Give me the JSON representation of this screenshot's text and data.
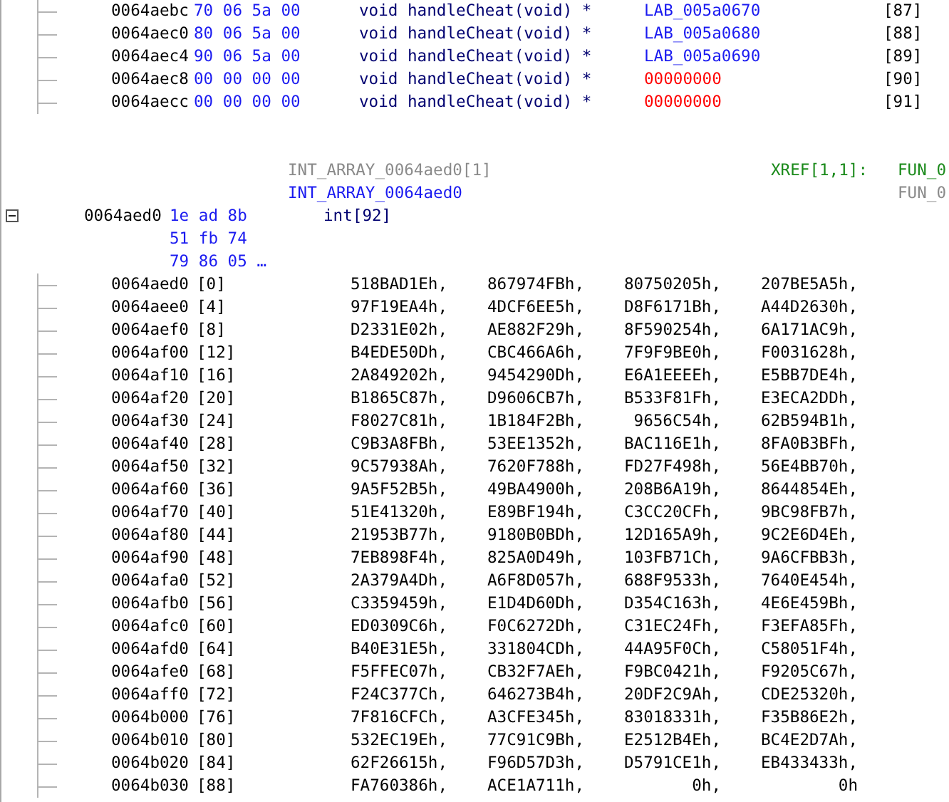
{
  "pointer_rows": [
    {
      "address": "0064aebc",
      "bytes": "70 06 5a 00",
      "type": "void handleCheat(void) *",
      "value": "LAB_005a0670",
      "kind": "label",
      "index": "[87]"
    },
    {
      "address": "0064aec0",
      "bytes": "80 06 5a 00",
      "type": "void handleCheat(void) *",
      "value": "LAB_005a0680",
      "kind": "label",
      "index": "[88]"
    },
    {
      "address": "0064aec4",
      "bytes": "90 06 5a 00",
      "type": "void handleCheat(void) *",
      "value": "LAB_005a0690",
      "kind": "label",
      "index": "[89]"
    },
    {
      "address": "0064aec8",
      "bytes": "00 00 00 00",
      "type": "void handleCheat(void) *",
      "value": "00000000",
      "kind": "null",
      "index": "[90]"
    },
    {
      "address": "0064aecc",
      "bytes": "00 00 00 00",
      "type": "void handleCheat(void) *",
      "value": "00000000",
      "kind": "null",
      "index": "[91]"
    }
  ],
  "array": {
    "offcut_label": "INT_ARRAY_0064aed0[1]",
    "label": "INT_ARRAY_0064aed0",
    "xref_title": "XREF[1,1]:",
    "xrefs": [
      {
        "text": "FUN_0",
        "kind": "reference"
      },
      {
        "text": "FUN_0",
        "kind": "offcut"
      }
    ],
    "expanded": true,
    "address": "0064aed0",
    "bytes": [
      "1e ad 8b",
      "51 fb 74",
      "79 86 05 …"
    ],
    "type": "int[92]"
  },
  "elements": [
    {
      "address": "0064aed0",
      "index": "[0]",
      "values": [
        "518BAD1Eh,",
        "867974FBh,",
        "80750205h,",
        "207BE5A5h,"
      ]
    },
    {
      "address": "0064aee0",
      "index": "[4]",
      "values": [
        "97F19EA4h,",
        "4DCF6EE5h,",
        "D8F6171Bh,",
        "A44D2630h,"
      ]
    },
    {
      "address": "0064aef0",
      "index": "[8]",
      "values": [
        "D2331E02h,",
        "AE882F29h,",
        "8F590254h,",
        "6A171AC9h,"
      ]
    },
    {
      "address": "0064af00",
      "index": "[12]",
      "values": [
        "B4EDE50Dh,",
        "CBC466A6h,",
        "7F9F9BE0h,",
        "F0031628h,"
      ]
    },
    {
      "address": "0064af10",
      "index": "[16]",
      "values": [
        "2A849202h,",
        "9454290Dh,",
        "E6A1EEEEh,",
        "E5BB7DE4h,"
      ]
    },
    {
      "address": "0064af20",
      "index": "[20]",
      "values": [
        "B1865C87h,",
        "D9606CB7h,",
        "B533F81Fh,",
        "E3ECA2DDh,"
      ]
    },
    {
      "address": "0064af30",
      "index": "[24]",
      "values": [
        "F8027C81h,",
        "1B184F2Bh,",
        "9656C54h,",
        "62B594B1h,"
      ]
    },
    {
      "address": "0064af40",
      "index": "[28]",
      "values": [
        "C9B3A8FBh,",
        "53EE1352h,",
        "BAC116E1h,",
        "8FA0B3BFh,"
      ]
    },
    {
      "address": "0064af50",
      "index": "[32]",
      "values": [
        "9C57938Ah,",
        "7620F788h,",
        "FD27F498h,",
        "56E4BB70h,"
      ]
    },
    {
      "address": "0064af60",
      "index": "[36]",
      "values": [
        "9A5F52B5h,",
        "49BA4900h,",
        "208B6A19h,",
        "8644854Eh,"
      ]
    },
    {
      "address": "0064af70",
      "index": "[40]",
      "values": [
        "51E41320h,",
        "E89BF194h,",
        "C3CC20CFh,",
        "9BC98FB7h,"
      ]
    },
    {
      "address": "0064af80",
      "index": "[44]",
      "values": [
        "21953B77h,",
        "9180B0BDh,",
        "12D165A9h,",
        "9C2E6D4Eh,"
      ]
    },
    {
      "address": "0064af90",
      "index": "[48]",
      "values": [
        "7EB898F4h,",
        "825A0D49h,",
        "103FB71Ch,",
        "9A6CFBB3h,"
      ]
    },
    {
      "address": "0064afa0",
      "index": "[52]",
      "values": [
        "2A379A4Dh,",
        "A6F8D057h,",
        "688F9533h,",
        "7640E454h,"
      ]
    },
    {
      "address": "0064afb0",
      "index": "[56]",
      "values": [
        "C3359459h,",
        "E1D4D60Dh,",
        "D354C163h,",
        "4E6E459Bh,"
      ]
    },
    {
      "address": "0064afc0",
      "index": "[60]",
      "values": [
        "ED0309C6h,",
        "F0C6272Dh,",
        "C31EC24Fh,",
        "F3EFA85Fh,"
      ]
    },
    {
      "address": "0064afd0",
      "index": "[64]",
      "values": [
        "B40E31E5h,",
        "331804CDh,",
        "44A95F0Ch,",
        "C58051F4h,"
      ]
    },
    {
      "address": "0064afe0",
      "index": "[68]",
      "values": [
        "F5FFEC07h,",
        "CB32F7AEh,",
        "F9BC0421h,",
        "F9205C67h,"
      ]
    },
    {
      "address": "0064aff0",
      "index": "[72]",
      "values": [
        "F24C377Ch,",
        "646273B4h,",
        "20DF2C9Ah,",
        "CDE25320h,"
      ]
    },
    {
      "address": "0064b000",
      "index": "[76]",
      "values": [
        "7F816CFCh,",
        "A3CFE345h,",
        "83018331h,",
        "F35B86E2h,"
      ]
    },
    {
      "address": "0064b010",
      "index": "[80]",
      "values": [
        "532EC19Eh,",
        "77C91C9Bh,",
        "E2512B4Eh,",
        "BC4E2D7Ah,"
      ]
    },
    {
      "address": "0064b020",
      "index": "[84]",
      "values": [
        "62F26615h,",
        "F96D57D3h,",
        "D5791CE1h,",
        "EB433433h,"
      ]
    },
    {
      "address": "0064b030",
      "index": "[88]",
      "values": [
        "FA760386h,",
        "ACE1A711h,",
        "0h,",
        "0h"
      ]
    }
  ]
}
